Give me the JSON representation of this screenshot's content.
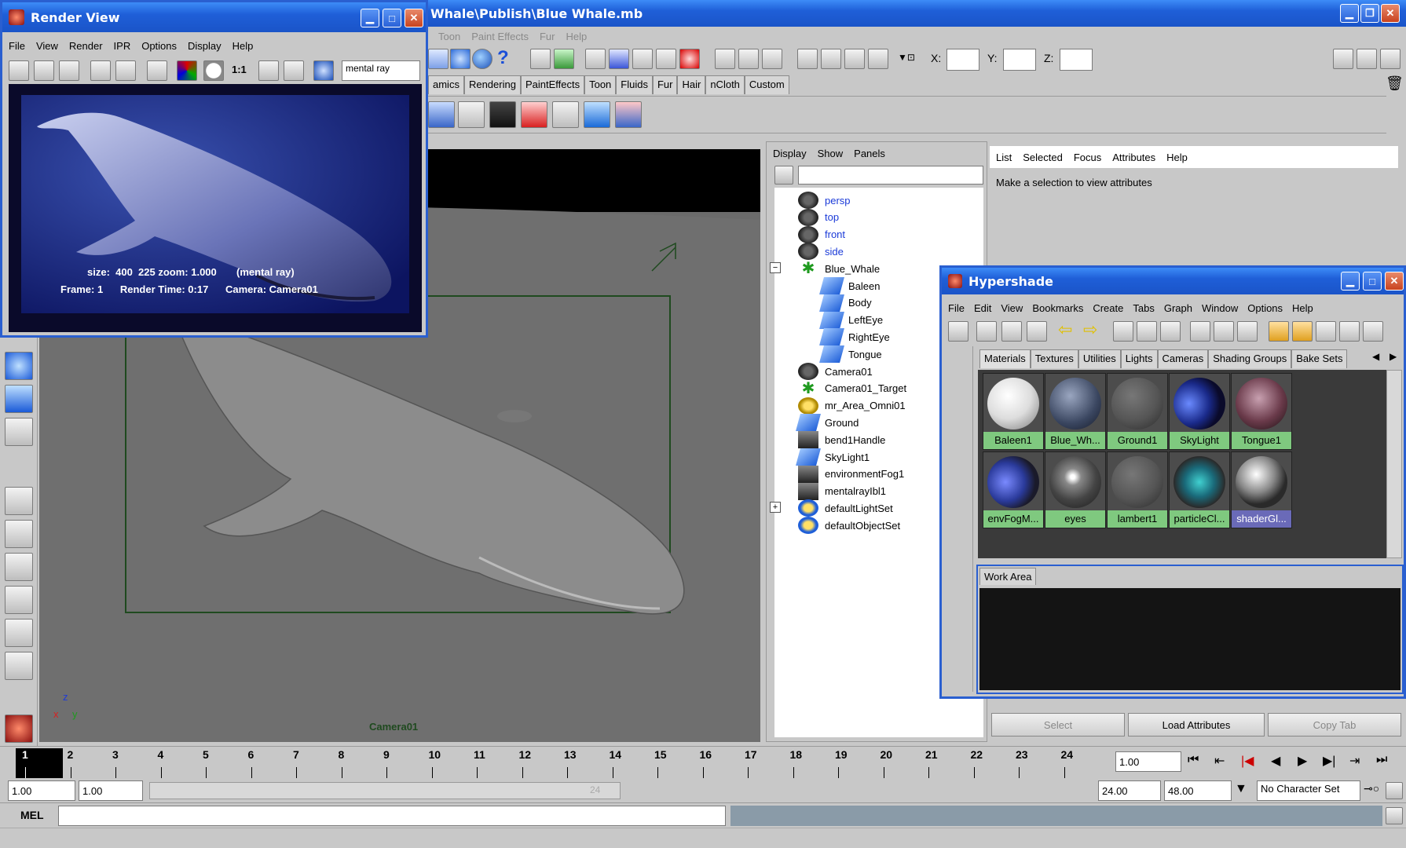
{
  "main_window": {
    "title": "Whale\\Publish\\Blue Whale.mb",
    "menus": [
      "Toon",
      "Paint Effects",
      "Fur",
      "Help"
    ],
    "shelf_tabs": [
      "amics",
      "Rendering",
      "PaintEffects",
      "Toon",
      "Fluids",
      "Fur",
      "Hair",
      "nCloth",
      "Custom"
    ],
    "xyz": {
      "x": "X:",
      "y": "Y:",
      "z": "Z:"
    }
  },
  "render_view": {
    "title": "Render View",
    "menus": [
      "File",
      "View",
      "Render",
      "IPR",
      "Options",
      "Display",
      "Help"
    ],
    "renderer_field": "mental ray",
    "ratio_label": "1:1",
    "info_line1": "size:  400  225 zoom: 1.000       (mental ray)",
    "info_line2": "Frame: 1      Render Time: 0:17      Camera: Camera01"
  },
  "viewport": {
    "camera_label": "Camera01",
    "axis": {
      "x": "x",
      "y": "y",
      "z": "z"
    }
  },
  "outliner": {
    "menus": [
      "Display",
      "Show",
      "Panels"
    ],
    "items": [
      {
        "label": "persp",
        "indent": 0,
        "icon": "camera-icon",
        "blue": true
      },
      {
        "label": "top",
        "indent": 0,
        "icon": "camera-icon",
        "blue": true
      },
      {
        "label": "front",
        "indent": 0,
        "icon": "camera-icon",
        "blue": true
      },
      {
        "label": "side",
        "indent": 0,
        "icon": "camera-icon",
        "blue": true
      },
      {
        "label": "Blue_Whale",
        "indent": 0,
        "icon": "group-icon",
        "expand": "−"
      },
      {
        "label": "Baleen",
        "indent": 1,
        "icon": "mesh-icon"
      },
      {
        "label": "Body",
        "indent": 1,
        "icon": "mesh-icon"
      },
      {
        "label": "LeftEye",
        "indent": 1,
        "icon": "mesh-icon"
      },
      {
        "label": "RightEye",
        "indent": 1,
        "icon": "mesh-icon"
      },
      {
        "label": "Tongue",
        "indent": 1,
        "icon": "mesh-icon"
      },
      {
        "label": "Camera01",
        "indent": 0,
        "icon": "camera-icon"
      },
      {
        "label": "Camera01_Target",
        "indent": 0,
        "icon": "group-icon"
      },
      {
        "label": "mr_Area_Omni01",
        "indent": 0,
        "icon": "light-icon"
      },
      {
        "label": "Ground",
        "indent": 0,
        "icon": "mesh-icon"
      },
      {
        "label": "bend1Handle",
        "indent": 0,
        "icon": "deformer-icon"
      },
      {
        "label": "SkyLight1",
        "indent": 0,
        "icon": "mesh-icon"
      },
      {
        "label": "environmentFog1",
        "indent": 0,
        "icon": "deformer-icon"
      },
      {
        "label": "mentalrayIbl1",
        "indent": 0,
        "icon": "deformer-icon"
      },
      {
        "label": "defaultLightSet",
        "indent": 0,
        "icon": "set-icon",
        "expand": "+"
      },
      {
        "label": "defaultObjectSet",
        "indent": 0,
        "icon": "set-icon"
      }
    ]
  },
  "attribute_editor": {
    "menus": [
      "List",
      "Selected",
      "Focus",
      "Attributes",
      "Help"
    ],
    "message": "Make a selection to view attributes",
    "buttons": {
      "select": "Select",
      "load": "Load Attributes",
      "copy": "Copy Tab"
    }
  },
  "hypershade": {
    "title": "Hypershade",
    "menus": [
      "File",
      "Edit",
      "View",
      "Bookmarks",
      "Create",
      "Tabs",
      "Graph",
      "Window",
      "Options",
      "Help"
    ],
    "tabs": [
      "Materials",
      "Textures",
      "Utilities",
      "Lights",
      "Cameras",
      "Shading Groups",
      "Bake Sets"
    ],
    "materials": [
      {
        "label": "Baleen1",
        "style": "white"
      },
      {
        "label": "Blue_Wh...",
        "style": "bluegray"
      },
      {
        "label": "Ground1",
        "style": "gray"
      },
      {
        "label": "SkyLight",
        "style": "sky"
      },
      {
        "label": "Tongue1",
        "style": "tongue"
      },
      {
        "label": "envFogM...",
        "style": "envfog"
      },
      {
        "label": "eyes",
        "style": "eyes"
      },
      {
        "label": "lambert1",
        "style": "gray"
      },
      {
        "label": "particleCl...",
        "style": "particle"
      },
      {
        "label": "shaderGl...",
        "style": "glow",
        "selected": true
      }
    ],
    "work_area_tab": "Work Area"
  },
  "timeline": {
    "frames": [
      "1",
      "2",
      "3",
      "4",
      "5",
      "6",
      "7",
      "8",
      "9",
      "10",
      "11",
      "12",
      "13",
      "14",
      "15",
      "16",
      "17",
      "18",
      "19",
      "20",
      "21",
      "22",
      "23",
      "24"
    ],
    "current_frame": "1.00"
  },
  "range": {
    "start": "1.00",
    "playback_start": "1.00",
    "slider_end_label": "24",
    "playback_end": "24.00",
    "end": "48.00",
    "character_set": "No Character Set"
  },
  "command": {
    "label": "MEL"
  }
}
